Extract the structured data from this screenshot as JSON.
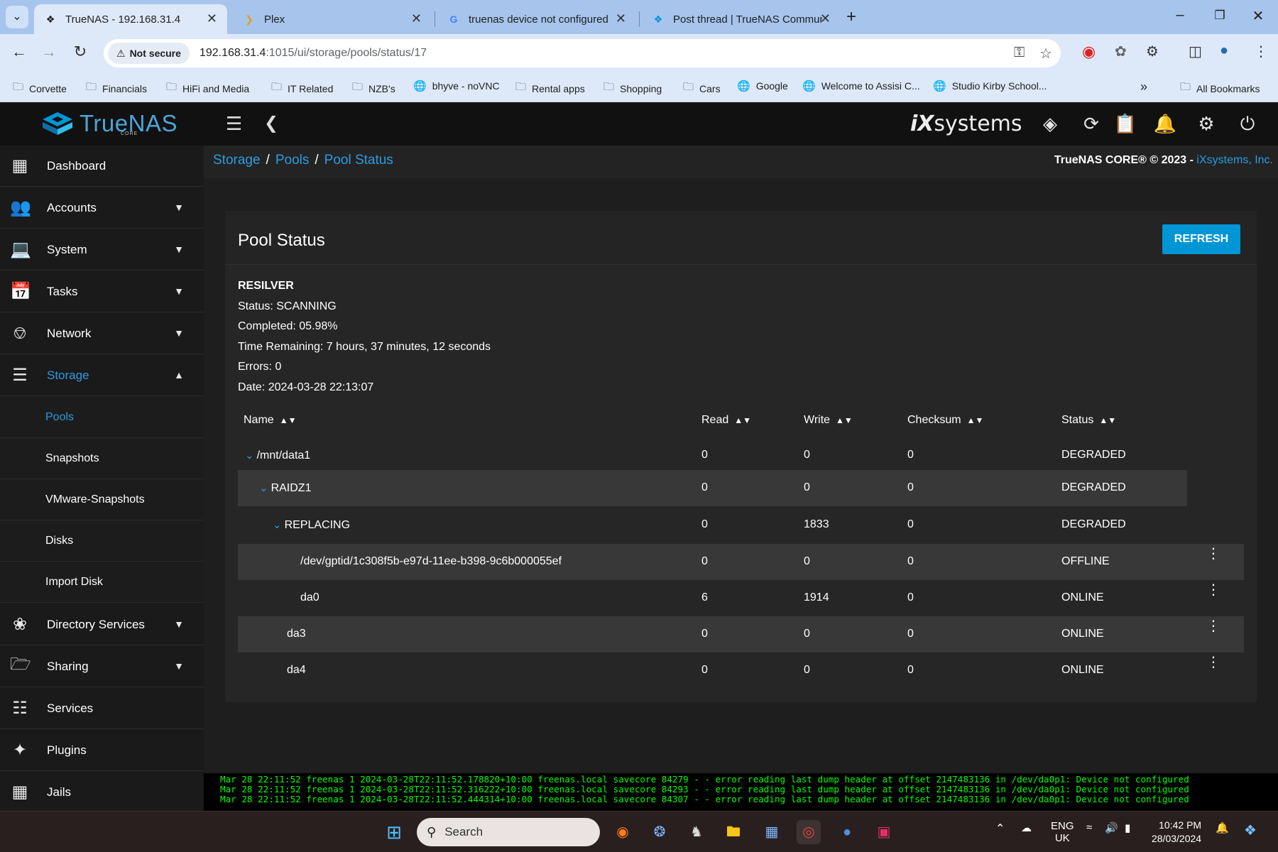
{
  "browser": {
    "tabs": [
      {
        "title": "TrueNAS - 192.168.31.4",
        "favicon": "truenas-icon"
      },
      {
        "title": "Plex",
        "favicon": "plex-icon"
      },
      {
        "title": "truenas device not configured",
        "favicon": "google-icon"
      },
      {
        "title": "Post thread | TrueNAS Commun",
        "favicon": "truenas-icon"
      }
    ],
    "security_chip": "Not secure",
    "url_host": "192.168.31.4",
    "url_rest": ":1015/ui/storage/pools/status/17",
    "bookmarks": [
      "Corvette",
      "Financials",
      "HiFi and Media",
      "IT Related",
      "NZB's",
      "bhyve - noVNC",
      "Rental apps",
      "Shopping",
      "Cars",
      "Google",
      "Welcome to Assisi C...",
      "Studio Kirby School..."
    ],
    "all_bookmarks": "All Bookmarks"
  },
  "app": {
    "logo_text": "TrueNAS",
    "logo_sub": "CORE",
    "brand": "systems",
    "brand_prefix": "iX"
  },
  "sidebar": {
    "items": [
      {
        "label": "Dashboard",
        "icon": "dashboard-icon"
      },
      {
        "label": "Accounts",
        "icon": "accounts-icon"
      },
      {
        "label": "System",
        "icon": "laptop-icon"
      },
      {
        "label": "Tasks",
        "icon": "calendar-icon"
      },
      {
        "label": "Network",
        "icon": "network-icon"
      },
      {
        "label": "Storage",
        "icon": "storage-icon"
      },
      {
        "label": "Directory Services",
        "icon": "directory-icon"
      },
      {
        "label": "Sharing",
        "icon": "sharing-icon"
      },
      {
        "label": "Services",
        "icon": "sliders-icon"
      },
      {
        "label": "Plugins",
        "icon": "puzzle-icon"
      },
      {
        "label": "Jails",
        "icon": "jails-icon"
      }
    ],
    "storage_sub": [
      "Pools",
      "Snapshots",
      "VMware-Snapshots",
      "Disks",
      "Import Disk"
    ]
  },
  "breadcrumb": [
    "Storage",
    "Pools",
    "Pool Status"
  ],
  "copyright": {
    "text": "TrueNAS CORE® © 2023 - ",
    "link": "iXsystems, Inc."
  },
  "card": {
    "title": "Pool Status",
    "refresh_label": "REFRESH",
    "resilver": {
      "heading": "RESILVER",
      "status": "Status: SCANNING",
      "completed": "Completed: 05.98%",
      "time_remaining": "Time Remaining: 7 hours, 37 minutes, 12 seconds",
      "errors": "Errors: 0",
      "date": "Date: 2024-03-28 22:13:07"
    },
    "columns": [
      "Name",
      "Read",
      "Write",
      "Checksum",
      "Status"
    ],
    "rows": [
      {
        "name": "/mnt/data1",
        "read": "0",
        "write": "0",
        "checksum": "0",
        "status": "DEGRADED"
      },
      {
        "name": "RAIDZ1",
        "read": "0",
        "write": "0",
        "checksum": "0",
        "status": "DEGRADED"
      },
      {
        "name": "REPLACING",
        "read": "0",
        "write": "1833",
        "checksum": "0",
        "status": "DEGRADED"
      },
      {
        "name": "/dev/gptid/1c308f5b-e97d-11ee-b398-9c6b000055ef",
        "read": "0",
        "write": "0",
        "checksum": "0",
        "status": "OFFLINE"
      },
      {
        "name": "da0",
        "read": "6",
        "write": "1914",
        "checksum": "0",
        "status": "ONLINE"
      },
      {
        "name": "da3",
        "read": "0",
        "write": "0",
        "checksum": "0",
        "status": "ONLINE"
      },
      {
        "name": "da4",
        "read": "0",
        "write": "0",
        "checksum": "0",
        "status": "ONLINE"
      }
    ]
  },
  "console": [
    "Mar 28 22:11:52 freenas 1 2024-03-28T22:11:52.178820+10:00 freenas.local savecore 84279 - - error reading last dump header at offset 2147483136 in /dev/da0p1: Device not configured",
    "Mar 28 22:11:52 freenas 1 2024-03-28T22:11:52.316222+10:00 freenas.local savecore 84293 - - error reading last dump header at offset 2147483136 in /dev/da0p1: Device not configured",
    "Mar 28 22:11:52 freenas 1 2024-03-28T22:11:52.444314+10:00 freenas.local savecore 84307 - - error reading last dump header at offset 2147483136 in /dev/da0p1: Device not configured"
  ],
  "taskbar": {
    "search_label": "Search",
    "lang_line1": "ENG",
    "lang_line2": "UK",
    "time": "10:42 PM",
    "date": "28/03/2024"
  },
  "colors": {
    "accent": "#0095d5",
    "link": "#2b9be0",
    "console_text": "#00ff00"
  }
}
